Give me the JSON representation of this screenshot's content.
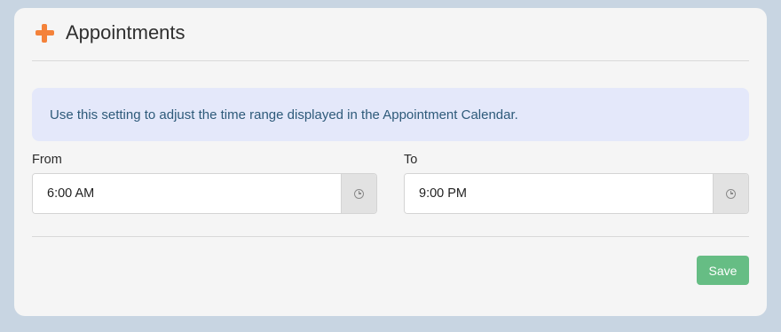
{
  "panel": {
    "title": "Appointments",
    "icon": "plus-icon",
    "accent_color": "#f4823a"
  },
  "info": {
    "message": "Use this setting to adjust the time range displayed in the Appointment Calendar."
  },
  "from": {
    "label": "From",
    "value": "6:00 AM",
    "icon": "clock-icon"
  },
  "to": {
    "label": "To",
    "value": "9:00 PM",
    "icon": "clock-icon"
  },
  "actions": {
    "save_label": "Save",
    "save_color": "#66bd84"
  }
}
